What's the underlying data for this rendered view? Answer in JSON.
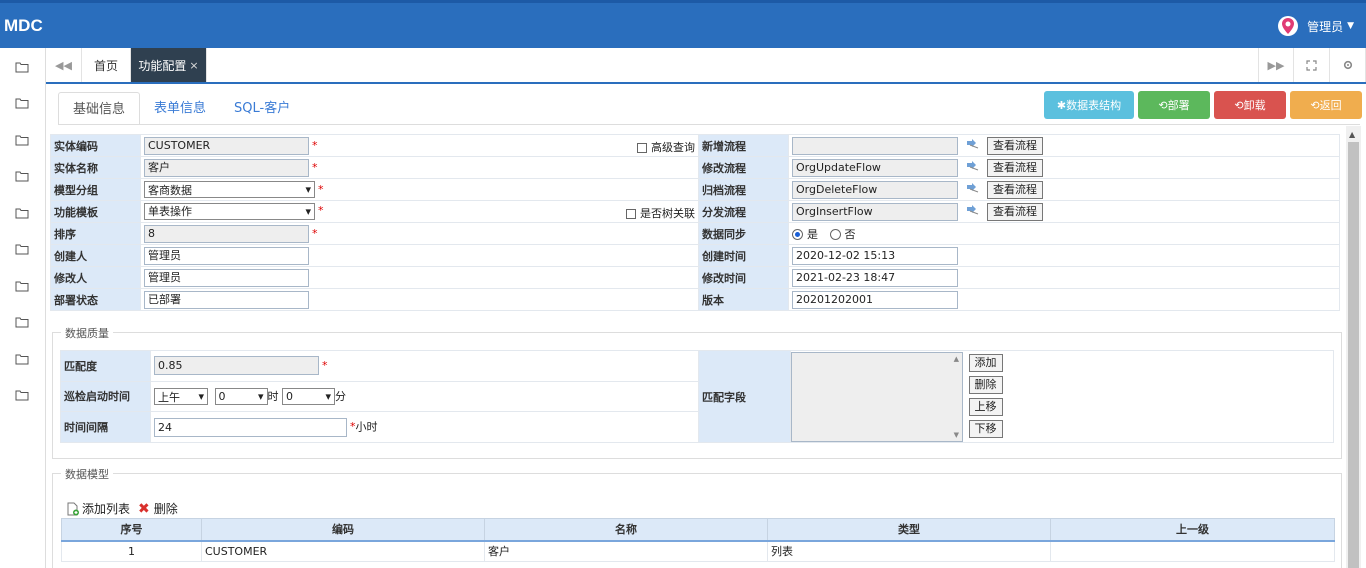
{
  "app": {
    "logo": "MDC",
    "user": "管理员"
  },
  "tabs": {
    "home": "首页",
    "active": "功能配置",
    "close": "×"
  },
  "subtabs": [
    "基础信息",
    "表单信息",
    "SQL-客户"
  ],
  "actions": {
    "schema": "数据表结构",
    "deploy": "部署",
    "undeploy": "卸载",
    "back": "返回"
  },
  "form": {
    "entity_code_label": "实体编码",
    "entity_code": "CUSTOMER",
    "entity_name_label": "实体名称",
    "entity_name": "客户",
    "model_group_label": "模型分组",
    "model_group": "客商数据",
    "func_template_label": "功能模板",
    "func_template": "单表操作",
    "order_label": "排序",
    "order": "8",
    "creator_label": "创建人",
    "creator": "管理员",
    "modifier_label": "修改人",
    "modifier": "管理员",
    "deploy_status_label": "部署状态",
    "deploy_status": "已部署",
    "advanced_query": "高级查询",
    "tree_link": "是否树关联",
    "add_flow_label": "新增流程",
    "add_flow": "",
    "update_flow_label": "修改流程",
    "update_flow": "OrgUpdateFlow",
    "archive_flow_label": "归档流程",
    "archive_flow": "OrgDeleteFlow",
    "dist_flow_label": "分发流程",
    "dist_flow": "OrgInsertFlow",
    "view_flow": "查看流程",
    "sync_label": "数据同步",
    "sync_yes": "是",
    "sync_no": "否",
    "create_time_label": "创建时间",
    "create_time": "2020-12-02 15:13",
    "modify_time_label": "修改时间",
    "modify_time": "2021-02-23 18:47",
    "version_label": "版本",
    "version": "20201202001"
  },
  "quality": {
    "legend": "数据质量",
    "match_label": "匹配度",
    "match": "0.85",
    "patrol_label": "巡检启动时间",
    "ampm": "上午",
    "hour": "0",
    "hour_unit": "时",
    "minute": "0",
    "minute_unit": "分",
    "interval_label": "时间间隔",
    "interval": "24",
    "interval_unit": "小时",
    "fields_label": "匹配字段",
    "buttons": [
      "添加",
      "删除",
      "上移",
      "下移"
    ]
  },
  "model": {
    "legend": "数据模型",
    "add": "添加列表",
    "delete": "删除",
    "columns": [
      "序号",
      "编码",
      "名称",
      "类型",
      "上一级"
    ],
    "rows": [
      [
        "1",
        "CUSTOMER",
        "客户",
        "列表",
        ""
      ]
    ]
  },
  "colors": {
    "header": "#2a6ebd",
    "label_bg": "#dce9f8"
  }
}
